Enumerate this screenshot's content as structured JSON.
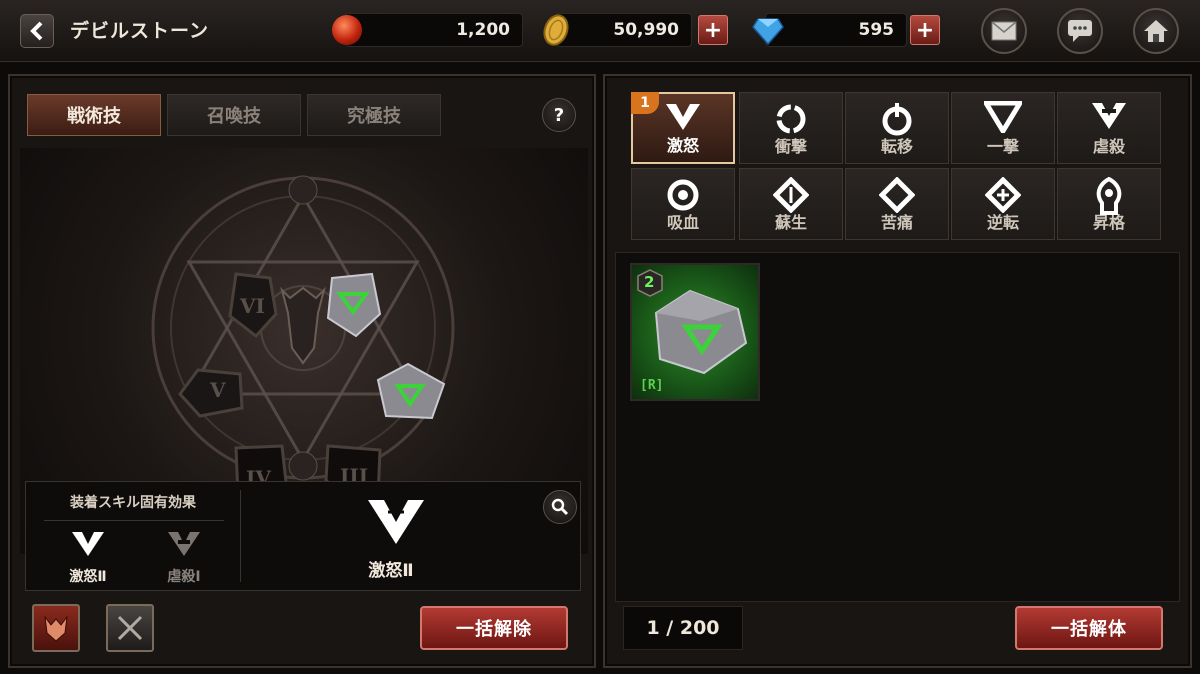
{
  "header": {
    "title": "デビルストーン",
    "resources": [
      {
        "name": "orb",
        "value": "1,200",
        "color": "#d8331c"
      },
      {
        "name": "gold",
        "value": "50,990",
        "color": "#d9a431"
      },
      {
        "name": "gem",
        "value": "595",
        "color": "#3fa3e6"
      }
    ],
    "plus_label": "+"
  },
  "left": {
    "tabs": [
      "戦術技",
      "召喚技",
      "究極技"
    ],
    "active_tab": 0,
    "help_label": "?",
    "runes": [
      "VI",
      "V",
      "IV",
      "III"
    ],
    "effect_title": "装着スキル固有効果",
    "effect_skills": [
      "激怒Ⅱ",
      "虐殺Ⅰ"
    ],
    "selected_skill": "激怒Ⅱ",
    "release_all_label": "一括解除"
  },
  "right": {
    "skills": [
      {
        "label": "激怒",
        "icon": "rage-icon",
        "badge": "1"
      },
      {
        "label": "衝撃",
        "icon": "impact-icon"
      },
      {
        "label": "転移",
        "icon": "transfer-icon"
      },
      {
        "label": "一撃",
        "icon": "strike-icon"
      },
      {
        "label": "虐殺",
        "icon": "slaughter-icon"
      },
      {
        "label": "吸血",
        "icon": "drain-icon"
      },
      {
        "label": "蘇生",
        "icon": "revive-icon"
      },
      {
        "label": "苦痛",
        "icon": "pain-icon"
      },
      {
        "label": "逆転",
        "icon": "reversal-icon"
      },
      {
        "label": "昇格",
        "icon": "ascend-icon"
      }
    ],
    "item": {
      "count": "2",
      "rarity": "[R]"
    },
    "page": "1 / 200",
    "dismantle_all_label": "一括解体"
  },
  "colors": {
    "accent_red": "#8a2219",
    "green_glow": "#2e8a2a",
    "badge_orange": "#d7741d"
  }
}
